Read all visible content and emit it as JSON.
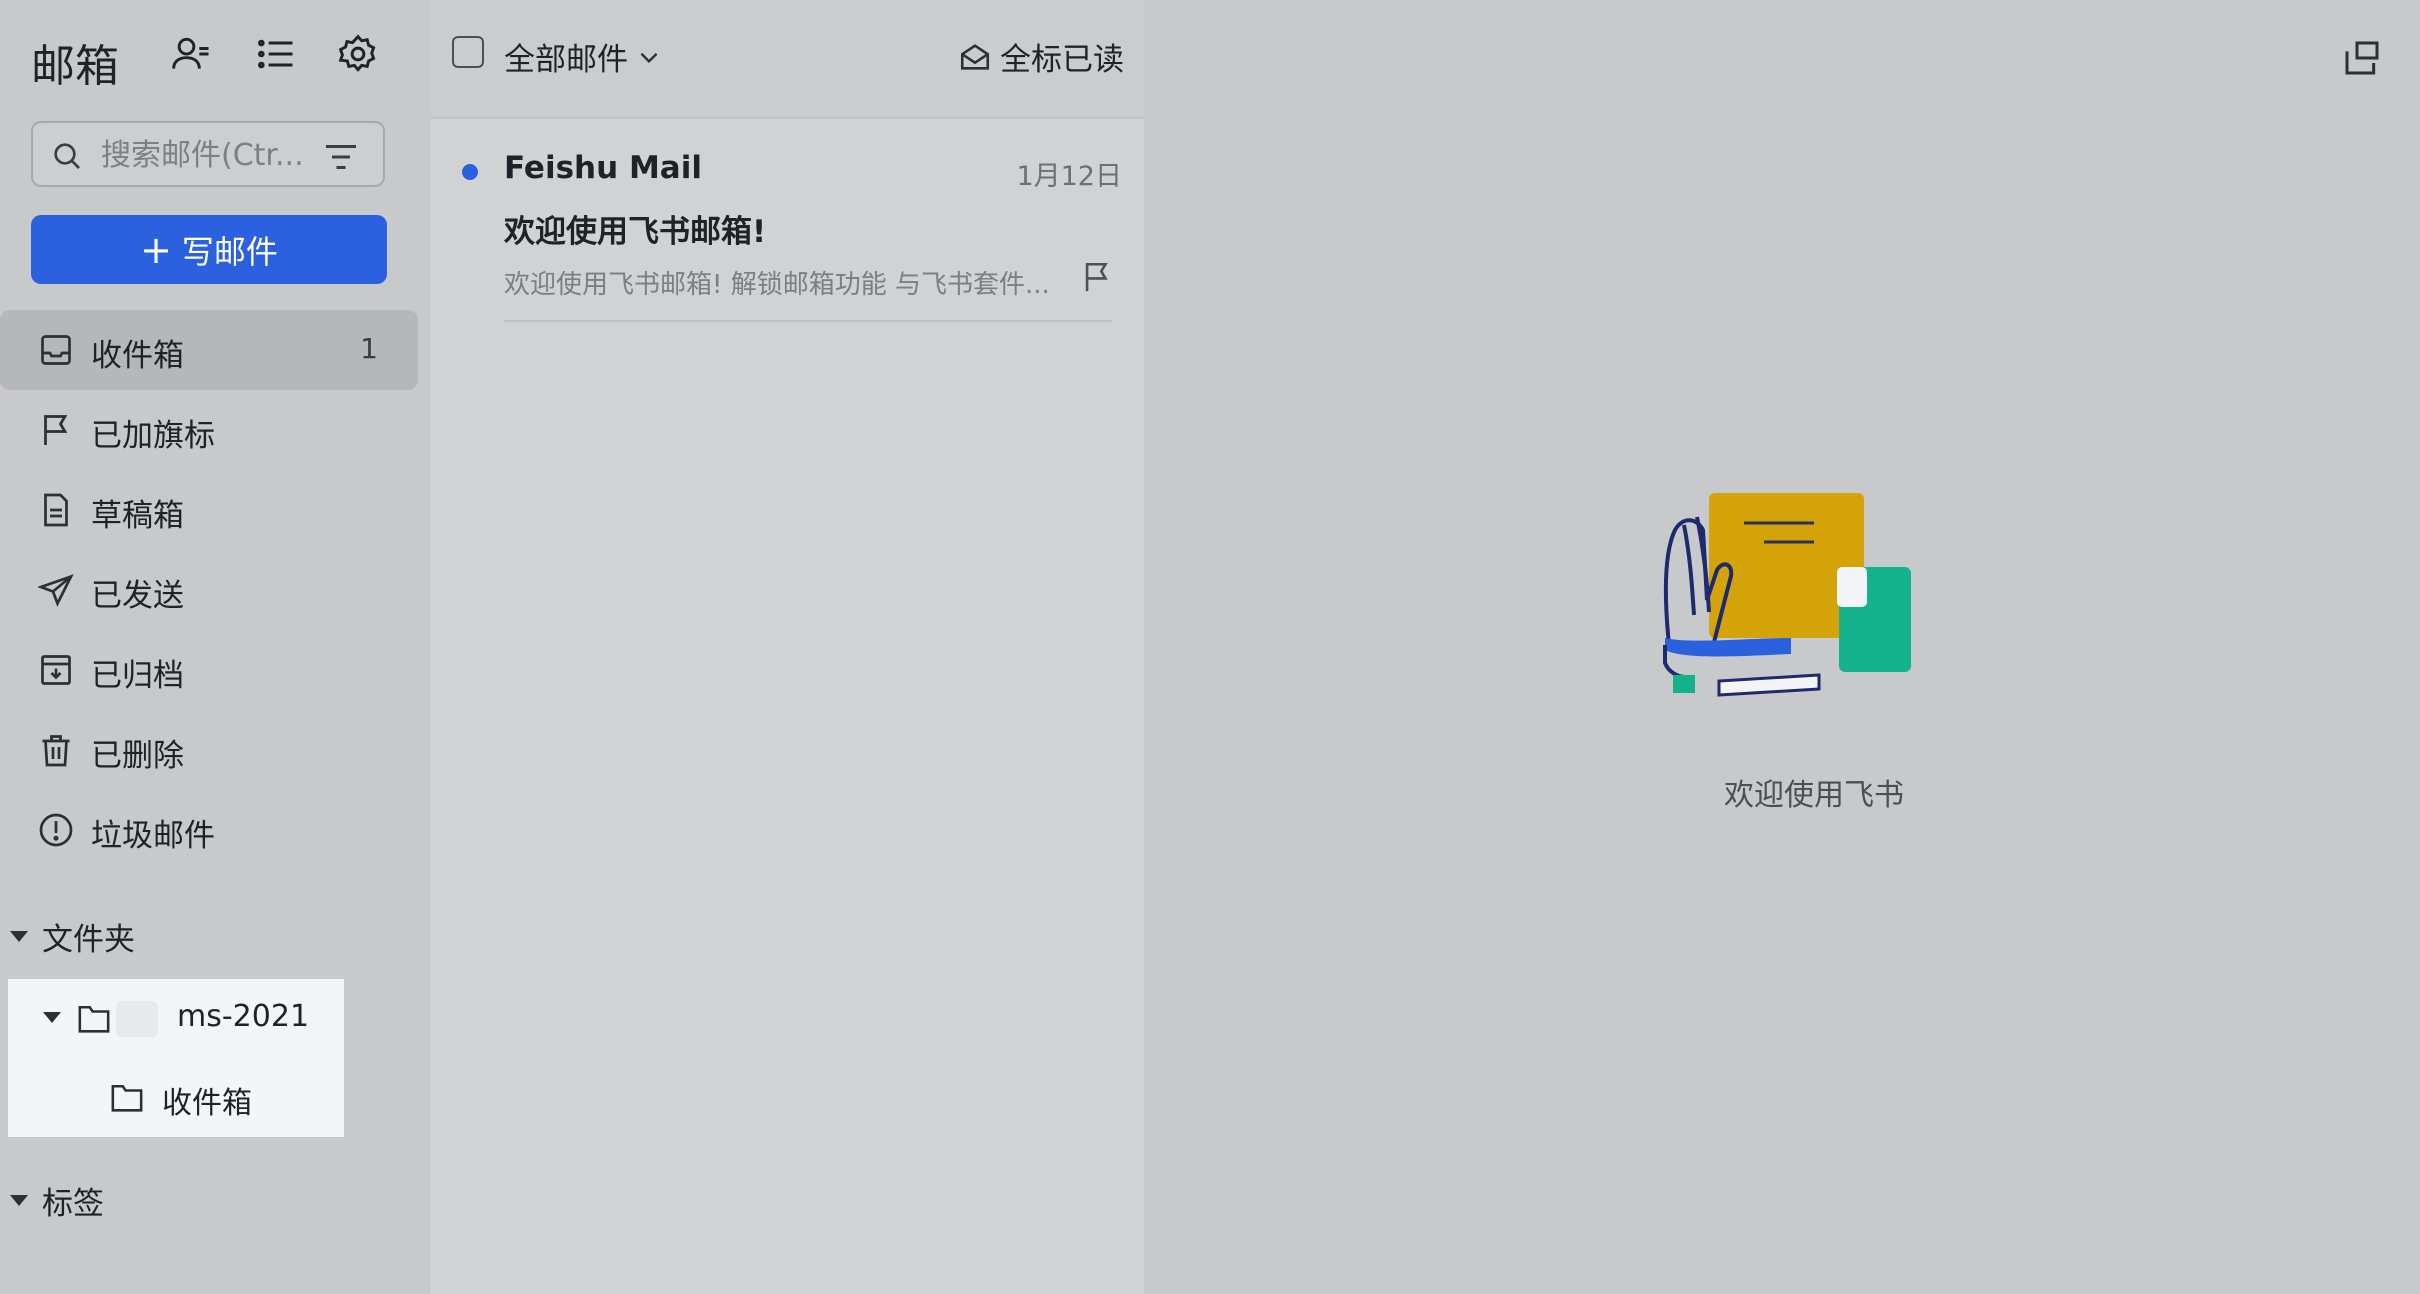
{
  "sidebar": {
    "title": "邮箱",
    "search": {
      "placeholder": "搜索邮件(Ctr..."
    },
    "compose_label": "写邮件",
    "nav": [
      {
        "label": "收件箱",
        "count": "1",
        "icon": "inbox-icon"
      },
      {
        "label": "已加旗标",
        "icon": "flag-icon"
      },
      {
        "label": "草稿箱",
        "icon": "draft-icon"
      },
      {
        "label": "已发送",
        "icon": "send-icon"
      },
      {
        "label": "已归档",
        "icon": "archive-icon"
      },
      {
        "label": "已删除",
        "icon": "trash-icon"
      },
      {
        "label": "垃圾邮件",
        "icon": "spam-icon"
      }
    ],
    "folders_label": "文件夹",
    "folder_tree": {
      "account": "ms-2021",
      "child": "收件箱"
    },
    "tags_label": "标签"
  },
  "list": {
    "filter_label": "全部邮件",
    "mark_all_read": "全标已读",
    "mails": [
      {
        "sender": "Feishu Mail",
        "date": "1月12日",
        "subject": "欢迎使用飞书邮箱!",
        "preview": "欢迎使用飞书邮箱! 解锁邮箱功能 与飞书套件..."
      }
    ]
  },
  "detail": {
    "empty_text": "欢迎使用飞书"
  },
  "colors": {
    "accent": "#2b60de",
    "illus_yellow": "#d4a30a",
    "illus_green": "#14b38e"
  }
}
